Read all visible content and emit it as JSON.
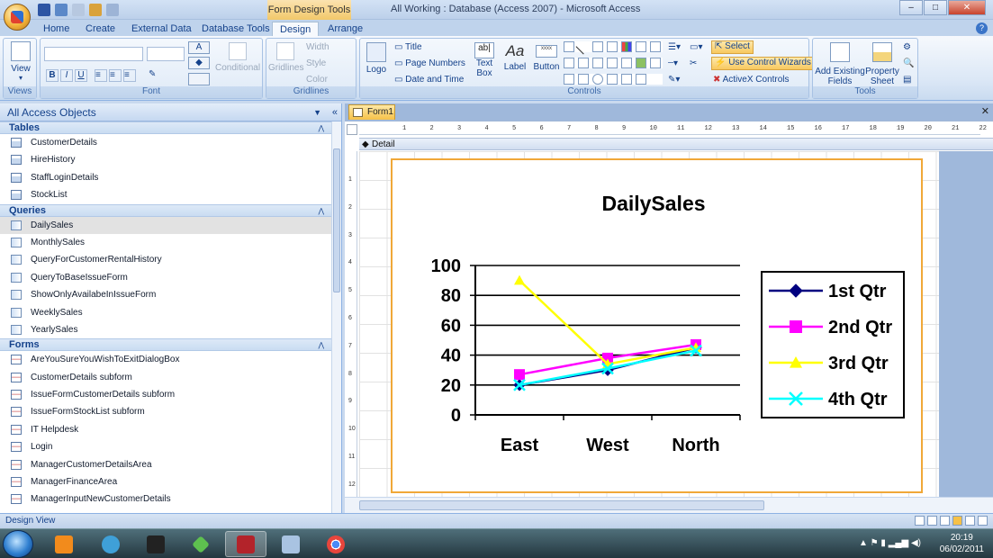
{
  "window": {
    "context_title": "Form Design Tools",
    "title": "All Working : Database (Access 2007) - Microsoft Access",
    "min": "–",
    "max": "□",
    "close": "✕"
  },
  "tabs": [
    "Home",
    "Create",
    "External Data",
    "Database Tools",
    "Design",
    "Arrange"
  ],
  "active_tab": "Design",
  "ribbon": {
    "views": {
      "view_label": "View",
      "group_label": "Views"
    },
    "font": {
      "conditional": "Conditional",
      "group_label": "Font",
      "bold": "B",
      "italic": "I",
      "underline": "U"
    },
    "gridlines": {
      "gridlines": "Gridlines",
      "width": "Width",
      "style": "Style",
      "color": "Color",
      "group_label": "Gridlines"
    },
    "controls": {
      "logo": "Logo",
      "title": "Title",
      "page_numbers": "Page Numbers",
      "date_time": "Date and Time",
      "text_box": "Text Box",
      "label": "Label",
      "button": "Button",
      "select": "Select",
      "use_control_wizards": "Use Control Wizards",
      "activex": "ActiveX Controls",
      "group_label": "Controls"
    },
    "tools": {
      "add_existing_fields": "Add Existing Fields",
      "property_sheet": "Property Sheet",
      "group_label": "Tools"
    }
  },
  "nav": {
    "header": "All Access Objects",
    "sections": [
      {
        "label": "Tables",
        "items": [
          "CustomerDetails",
          "HireHistory",
          "StaffLoginDetails",
          "StockList"
        ]
      },
      {
        "label": "Queries",
        "items": [
          "DailySales",
          "MonthlySales",
          "QueryForCustomerRentalHistory",
          "QueryToBaseIssueForm",
          "ShowOnlyAvailabeInIssueForm",
          "WeeklySales",
          "YearlySales"
        ]
      },
      {
        "label": "Forms",
        "items": [
          "AreYouSureYouWishToExitDialogBox",
          "CustomerDetails subform",
          "IssueFormCustomerDetails subform",
          "IssueFormStockList subform",
          "IT Helpdesk",
          "Login",
          "ManagerCustomerDetailsArea",
          "ManagerFinanceArea",
          "ManagerInputNewCustomerDetails"
        ]
      }
    ],
    "selected": "DailySales"
  },
  "document": {
    "tab": "Form1",
    "section": "Detail",
    "ruler_numbers": [
      "1",
      "2",
      "3",
      "4",
      "5",
      "6",
      "7",
      "8",
      "9",
      "10",
      "11",
      "12",
      "13",
      "14",
      "15",
      "16",
      "17",
      "18",
      "19",
      "20",
      "21",
      "22"
    ],
    "vruler_numbers": [
      "1",
      "2",
      "3",
      "4",
      "5",
      "6",
      "7",
      "8",
      "9",
      "10",
      "11",
      "12"
    ]
  },
  "chart_data": {
    "type": "line",
    "title": "DailySales",
    "categories": [
      "East",
      "West",
      "North"
    ],
    "ylim": [
      0,
      100
    ],
    "yticks": [
      0,
      20,
      40,
      60,
      80,
      100
    ],
    "grid": true,
    "legend": "right",
    "series": [
      {
        "name": "1st Qtr",
        "values": [
          20,
          30,
          45
        ],
        "color": "#000080",
        "marker": "diamond"
      },
      {
        "name": "2nd Qtr",
        "values": [
          27,
          38,
          47
        ],
        "color": "#ff00ff",
        "marker": "square"
      },
      {
        "name": "3rd Qtr",
        "values": [
          90,
          34,
          45
        ],
        "color": "#ffff00",
        "marker": "triangle"
      },
      {
        "name": "4th Qtr",
        "values": [
          20,
          31,
          43
        ],
        "color": "#00ffff",
        "marker": "x"
      }
    ]
  },
  "status": {
    "text": "Design View"
  },
  "taskbar": {
    "time": "20:19",
    "date": "06/02/2011"
  }
}
